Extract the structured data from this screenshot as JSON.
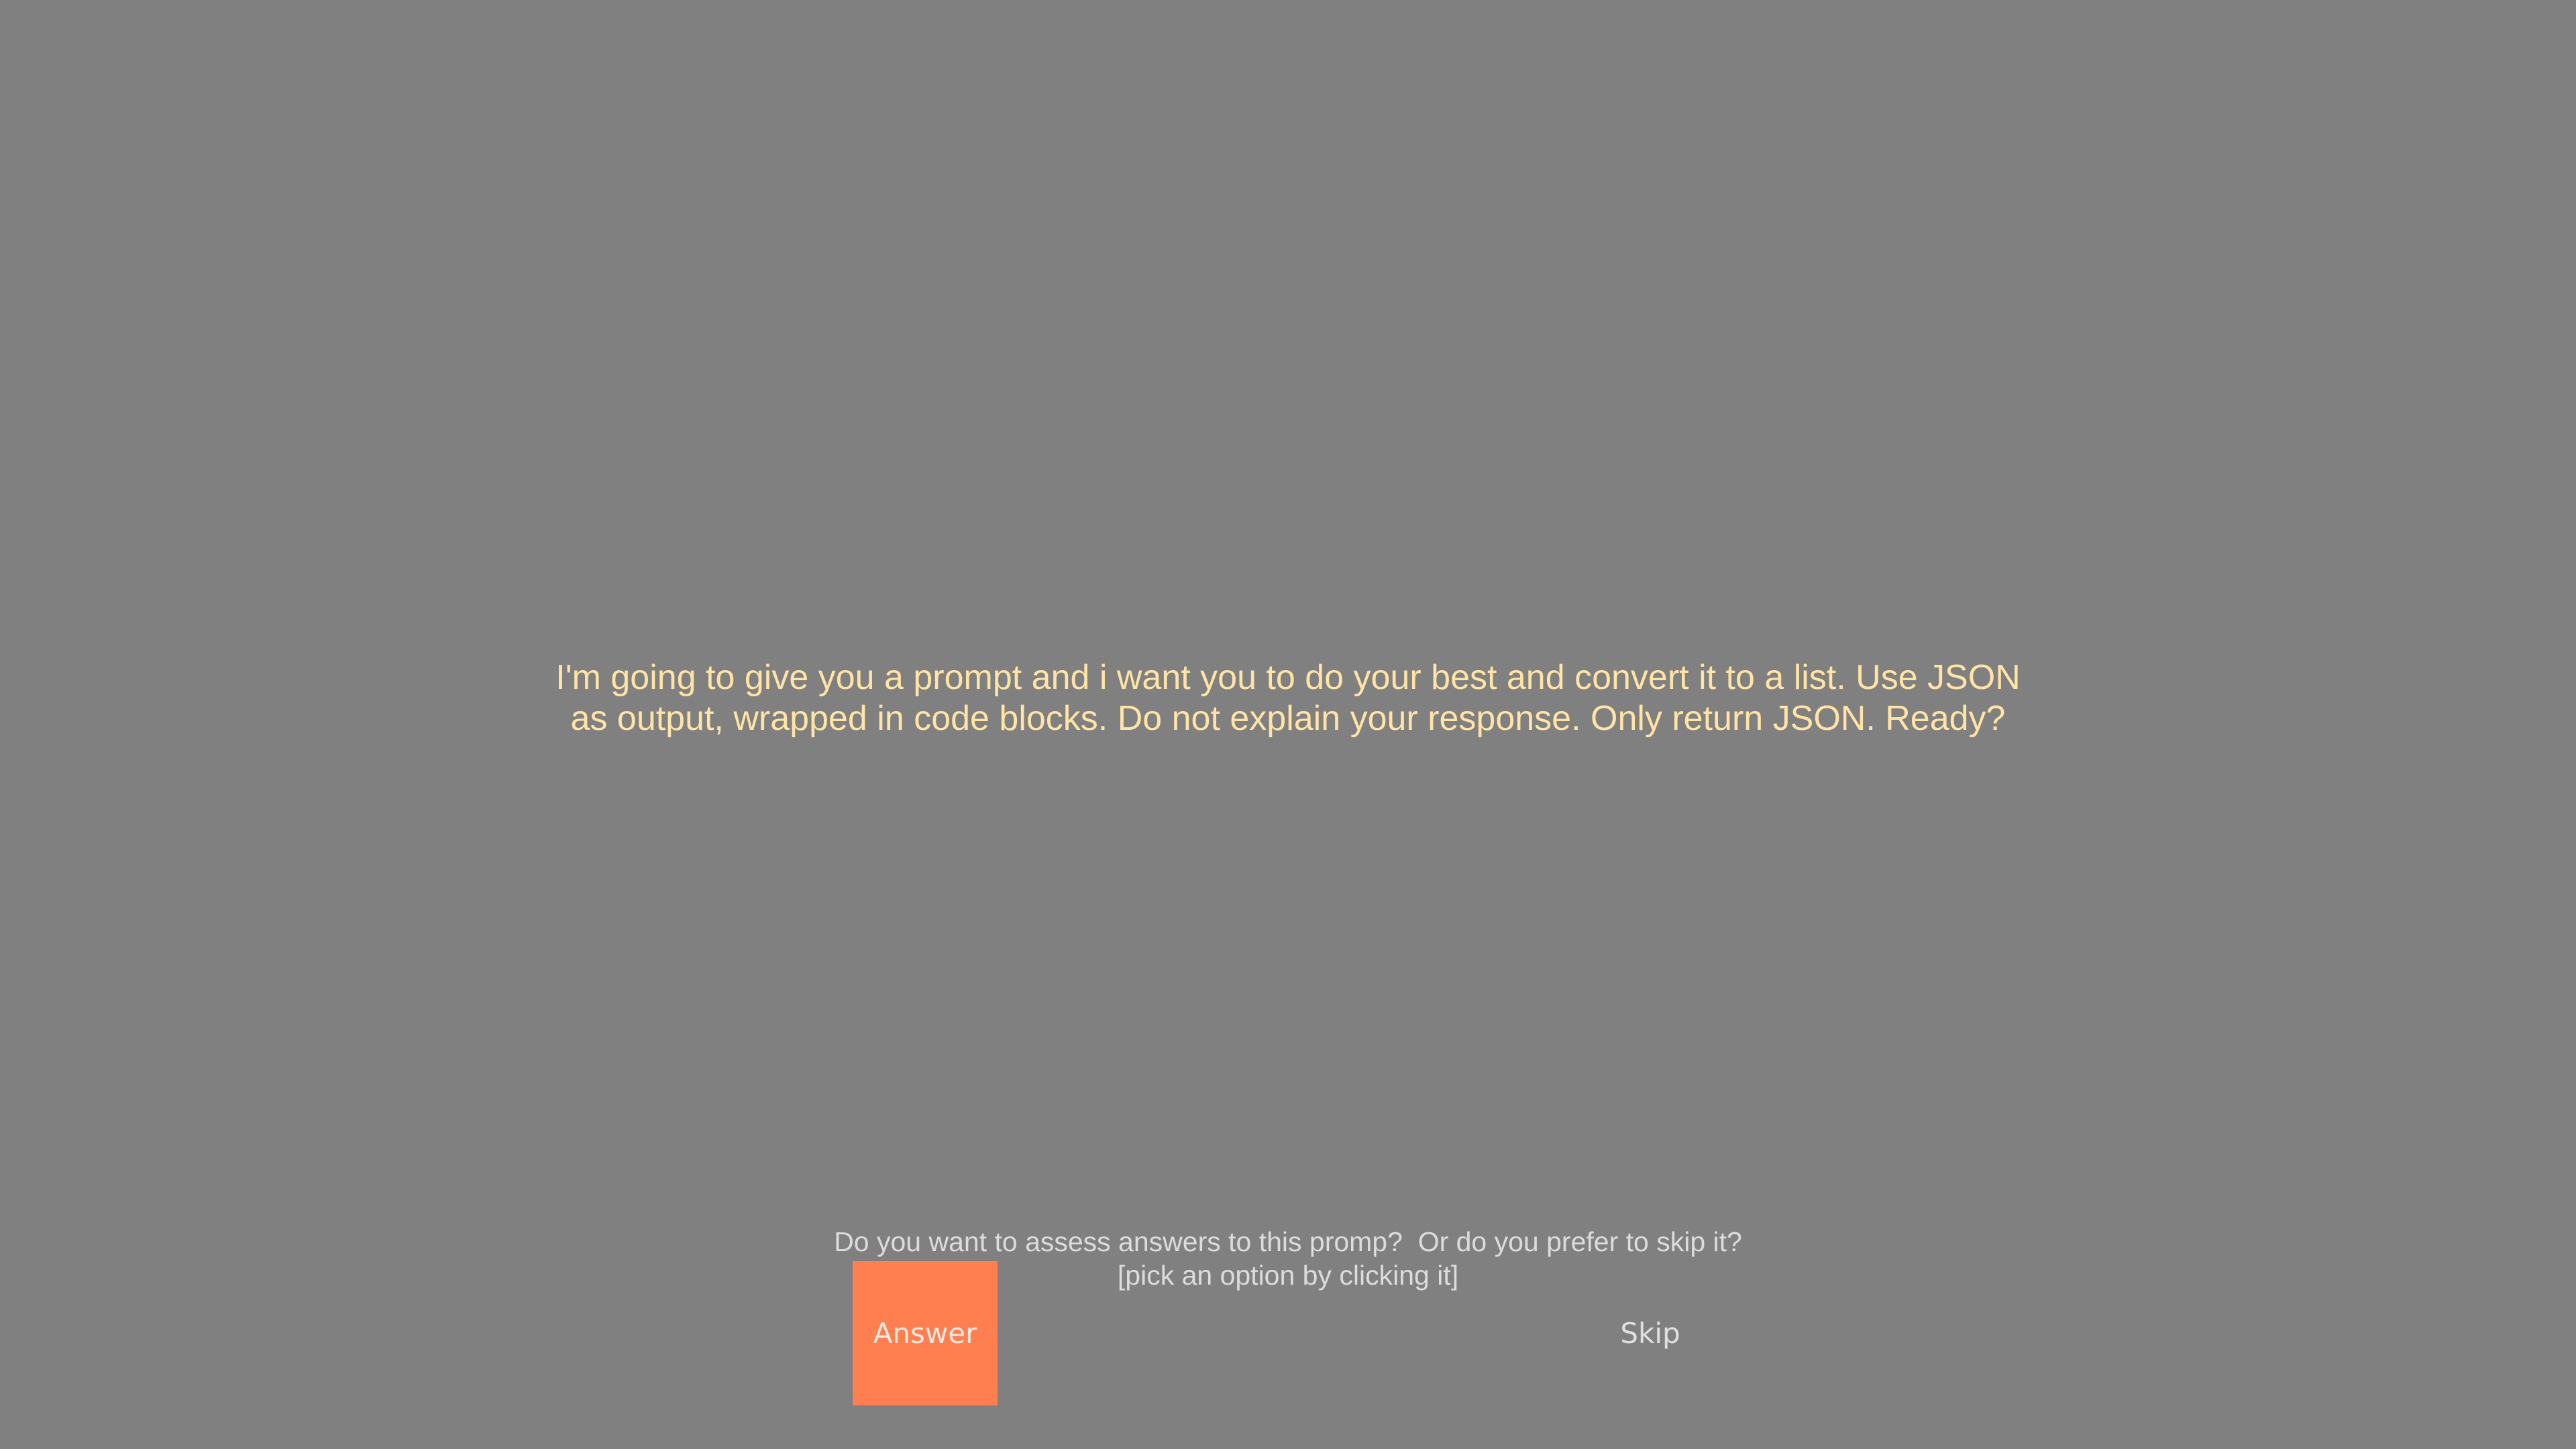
{
  "prompt": {
    "text": "I'm going to give you a prompt and i want you to do your best and convert it to a list. Use JSON as output, wrapped in code blocks. Do not explain your response. Only return JSON. Ready?"
  },
  "choice": {
    "question": "Do you want to assess answers to this promp?  Or do you prefer to skip it?",
    "hint": "[pick an option by clicking it]",
    "answer_label": "Answer",
    "skip_label": "Skip"
  },
  "colors": {
    "background": "#808080",
    "prompt_text": "#FFE4A6",
    "answer_button": "#FF7F50"
  }
}
